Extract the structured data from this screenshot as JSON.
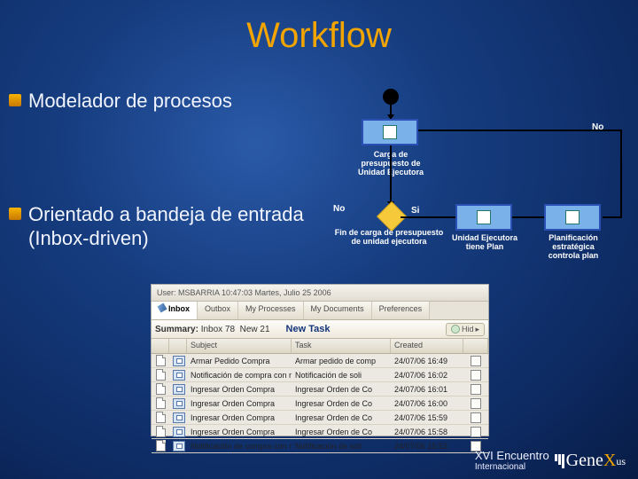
{
  "title": "Workflow",
  "bullets": {
    "b1": "Modelador de procesos",
    "b2": "Orientado a bandeja de entrada (Inbox-driven)"
  },
  "diagram": {
    "lbl1": "Carga de presupuesto de Unidad Ejecutora",
    "lbl2": "Fin de carga de presupuesto de unidad ejecutora",
    "lbl3": "Unidad Ejecutora tiene Plan",
    "lbl4": "Planificación estratégica controla plan",
    "no": "No",
    "si": "Si",
    "no2": "No"
  },
  "inbox": {
    "topbar": "User: MSBARRIA        10:47:03 Martes, Julio 25 2006",
    "tabs": {
      "t1": "Inbox",
      "t2": "Outbox",
      "t3": "My Processes",
      "t4": "My Documents",
      "t5": "Preferences"
    },
    "summary_label": "Summary:",
    "summary_inbox": "Inbox 78",
    "summary_new": "New 21",
    "newtask": "New Task",
    "hide": "Hid",
    "headers": {
      "subject": "Subject",
      "task": "Task",
      "created": "Created"
    },
    "rows": [
      {
        "s": "Armar Pedido Compra",
        "t": "Armar pedido de comp",
        "c": "24/07/06 16:49"
      },
      {
        "s": "Notificación de compra con rec ordene",
        "t": "Notificación de soli",
        "c": "24/07/06 16:02"
      },
      {
        "s": "Ingresar Orden Compra",
        "t": "Ingresar Orden de Co",
        "c": "24/07/06 16:01"
      },
      {
        "s": "Ingresar Orden Compra",
        "t": "Ingresar Orden de Co",
        "c": "24/07/06 16:00"
      },
      {
        "s": "Ingresar Orden Compra",
        "t": "Ingresar Orden de Co",
        "c": "24/07/06 15:59"
      },
      {
        "s": "Ingresar Orden Compra",
        "t": "Ingresar Orden de Co",
        "c": "24/07/06 15:58"
      },
      {
        "s": "Notificación de compra con rec ordene",
        "t": "Notificación de soli",
        "c": "24/07/06 15:53"
      }
    ]
  },
  "footer": {
    "line1": "XVI Encuentro",
    "line2": "Internacional",
    "brand_a": "Gene",
    "brand_b": "X",
    "brand_c": "us"
  }
}
